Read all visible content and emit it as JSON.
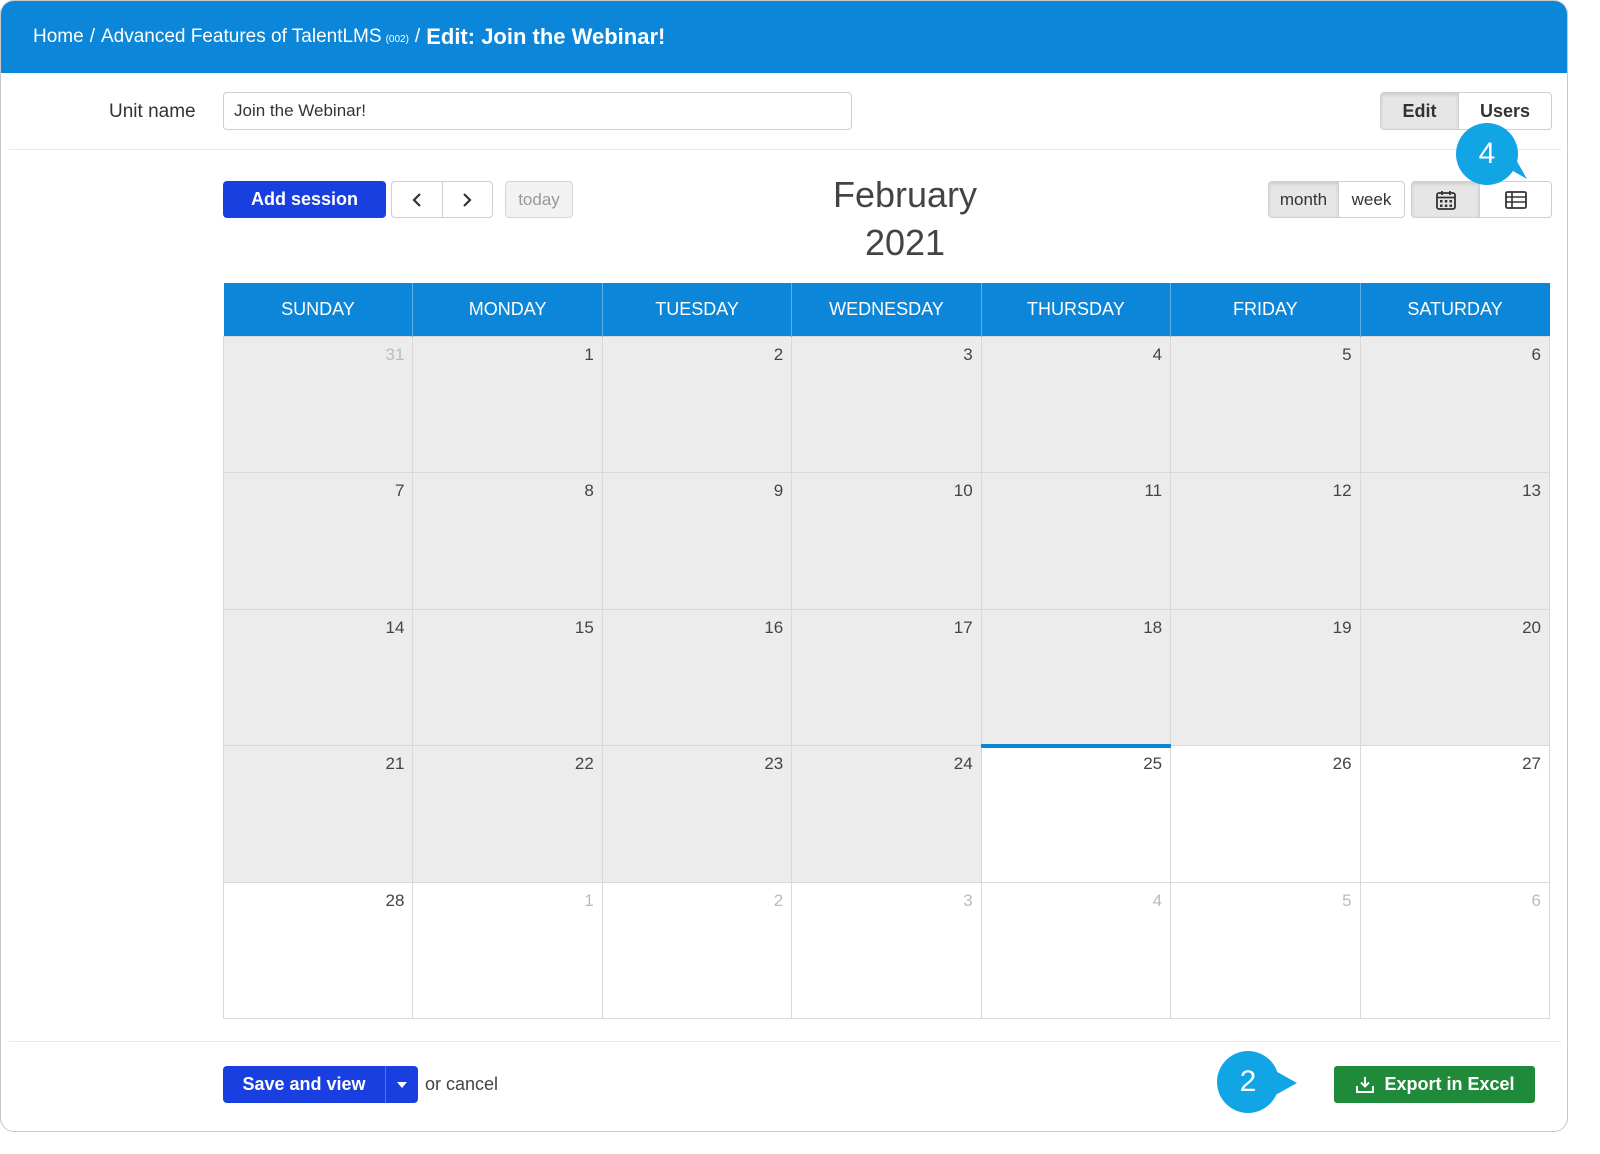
{
  "breadcrumb": {
    "home": "Home",
    "course": "Advanced Features of TalentLMS",
    "course_code": "(002)",
    "separator": "/",
    "current": "Edit: Join the Webinar!"
  },
  "unit": {
    "label": "Unit name",
    "value": "Join the Webinar!"
  },
  "mode_tabs": {
    "edit": "Edit",
    "users": "Users",
    "active": "Edit"
  },
  "toolbar": {
    "add_session": "Add session",
    "prev_icon": "chevron-left-icon",
    "next_icon": "chevron-right-icon",
    "today": "today",
    "title_month": "February",
    "title_year": "2021",
    "view_month": "month",
    "view_week": "week",
    "active_view": "month",
    "calendar_icon": "calendar-icon",
    "list_icon": "table-list-icon"
  },
  "calendar": {
    "weekdays": [
      "SUNDAY",
      "MONDAY",
      "TUESDAY",
      "WEDNESDAY",
      "THURSDAY",
      "FRIDAY",
      "SATURDAY"
    ],
    "weeks": [
      [
        "31",
        "1",
        "2",
        "3",
        "4",
        "5",
        "6"
      ],
      [
        "7",
        "8",
        "9",
        "10",
        "11",
        "12",
        "13"
      ],
      [
        "14",
        "15",
        "16",
        "17",
        "18",
        "19",
        "20"
      ],
      [
        "21",
        "22",
        "23",
        "24",
        "25",
        "26",
        "27"
      ],
      [
        "28",
        "1",
        "2",
        "3",
        "4",
        "5",
        "6"
      ]
    ],
    "today": "25"
  },
  "footer": {
    "save": "Save and view",
    "cancel": "or cancel",
    "export": "Export in Excel"
  },
  "callouts": {
    "top": "4",
    "bottom": "2"
  },
  "colors": {
    "header_blue": "#0b86d8",
    "primary_button": "#1a3fe0",
    "export_green": "#1f8b3a",
    "callout": "#12a5e6",
    "past_day_bg": "#ececec"
  }
}
